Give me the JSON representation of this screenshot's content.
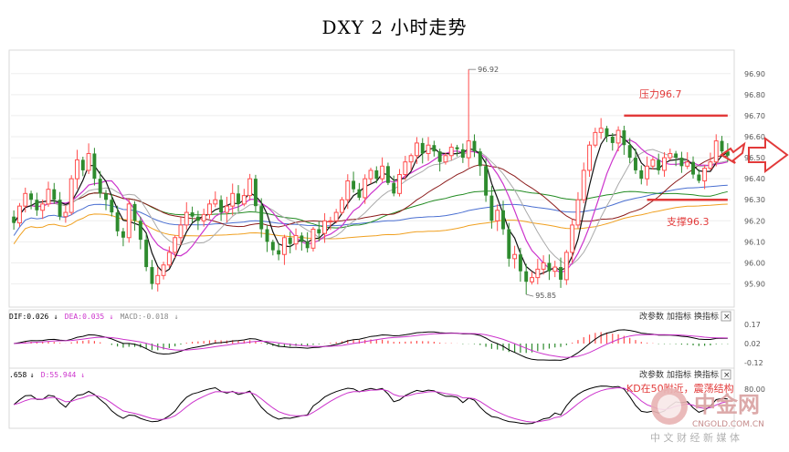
{
  "title": "DXY 2 小时走势",
  "chart_data": {
    "type": "candlestick",
    "title": "DXY 2 小时走势",
    "ylim": [
      95.82,
      96.99
    ],
    "yticks": [
      95.9,
      96.0,
      96.1,
      96.2,
      96.3,
      96.4,
      96.5,
      96.6,
      96.7,
      96.8,
      96.9
    ],
    "ytick_labels": [
      "95.90",
      "96.00",
      "96.10",
      "96.20",
      "96.30",
      "96.40",
      "96.50",
      "96.60",
      "96.70",
      "96.80",
      "96.90"
    ],
    "closes": [
      96.19,
      96.27,
      96.33,
      96.3,
      96.25,
      96.28,
      96.35,
      96.3,
      96.22,
      96.24,
      96.4,
      96.49,
      96.44,
      96.52,
      96.4,
      96.33,
      96.3,
      96.24,
      96.15,
      96.12,
      96.28,
      96.2,
      96.11,
      95.98,
      95.9,
      95.94,
      95.99,
      96.05,
      96.12,
      96.18,
      96.24,
      96.22,
      96.2,
      96.23,
      96.28,
      96.3,
      96.24,
      96.27,
      96.33,
      96.28,
      96.32,
      96.4,
      96.27,
      96.16,
      96.1,
      96.06,
      96.04,
      96.12,
      96.09,
      96.13,
      96.1,
      96.07,
      96.16,
      96.14,
      96.2,
      96.2,
      96.24,
      96.3,
      96.39,
      96.35,
      96.31,
      96.4,
      96.44,
      96.4,
      96.46,
      96.38,
      96.33,
      96.42,
      96.48,
      96.51,
      96.57,
      96.52,
      96.56,
      96.53,
      96.48,
      96.51,
      96.55,
      96.54,
      96.5,
      96.58,
      96.53,
      96.46,
      96.32,
      96.2,
      96.25,
      96.16,
      96.02,
      96.04,
      95.96,
      95.91,
      95.93,
      95.97,
      96.0,
      95.96,
      95.98,
      95.92,
      96.05,
      96.18,
      96.3,
      96.44,
      96.56,
      96.62,
      96.64,
      96.6,
      96.57,
      96.63,
      96.56,
      96.5,
      96.44,
      96.4,
      96.46,
      96.49,
      96.44,
      96.5,
      96.52,
      96.5,
      96.46,
      96.48,
      96.42,
      96.39,
      96.45,
      96.48,
      96.58,
      96.53,
      96.51
    ],
    "annotations": {
      "high_label": "96.92",
      "low_label": "95.85",
      "resistance_label": "压力96.7",
      "resistance_value": 96.7,
      "support_label": "支撑96.3",
      "support_value": 96.3
    },
    "macd": {
      "label_dif": "DIF:0.026",
      "label_dea": "DEA:0.035",
      "label_macd": "MACD:-0.018",
      "ytick_labels": [
        "0.17",
        "0.02",
        "-0.12"
      ]
    },
    "kdj": {
      "label_k": ".658",
      "label_d": "D:55.944",
      "ytick_labels": [
        "80.00"
      ],
      "annotation": "KD在50附近，震荡结构"
    }
  },
  "panel_buttons": {
    "params": "改参数",
    "add": "加指标",
    "switch": "换指标",
    "close": "×"
  },
  "watermark": {
    "brand": "中金网",
    "site": "CNGOLD.COM.CN",
    "tagline": "中 文 财 经 新 媒 体"
  },
  "colors": {
    "up_candle": "#ff4d4d",
    "down_candle": "#2e8b2e",
    "annotation": "#e23a3a",
    "ma_black": "#111111",
    "ma_magenta": "#cc33cc",
    "ma_gray": "#aaaaaa",
    "ma_darkred": "#8b1a1a",
    "ma_green": "#228b22",
    "ma_blue": "#4a6fd1",
    "ma_orange": "#f0a020"
  }
}
